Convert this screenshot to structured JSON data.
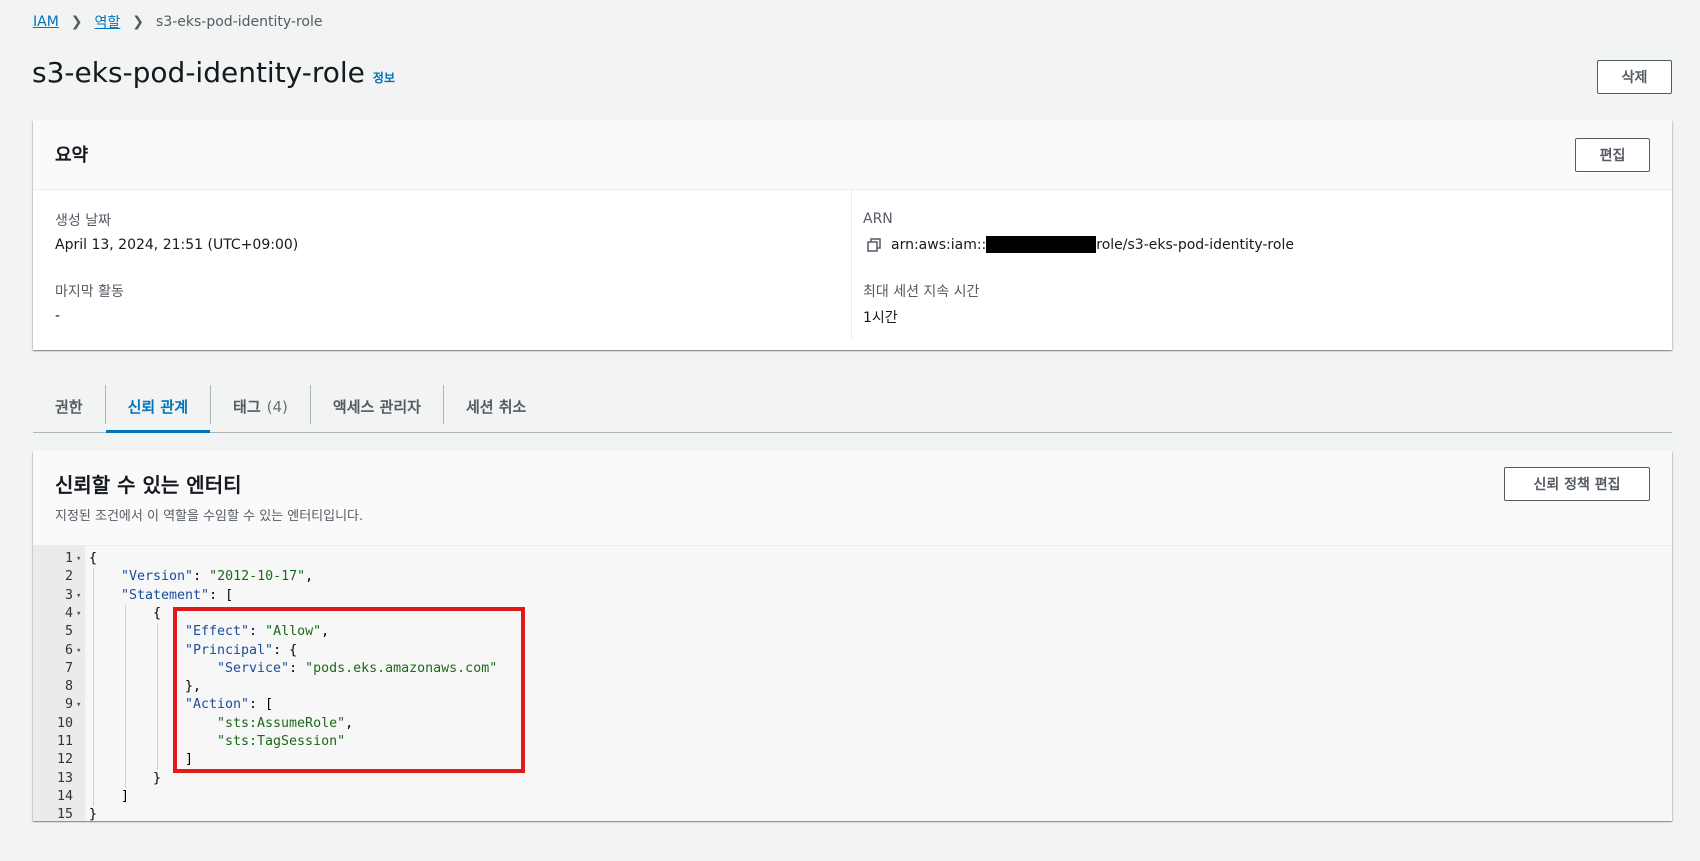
{
  "breadcrumb": {
    "items": [
      "IAM",
      "역할",
      "s3-eks-pod-identity-role"
    ]
  },
  "header": {
    "title": "s3-eks-pod-identity-role",
    "info_link": "정보",
    "delete_label": "삭제"
  },
  "summary": {
    "title": "요약",
    "edit_label": "편집",
    "created_label": "생성 날짜",
    "created_value": "April 13, 2024, 21:51 (UTC+09:00)",
    "last_activity_label": "마지막 활동",
    "last_activity_value": "-",
    "arn_label": "ARN",
    "arn_prefix": "arn:aws:iam::",
    "arn_suffix": "role/s3-eks-pod-identity-role",
    "max_session_label": "최대 세션 지속 시간",
    "max_session_value": "1시간"
  },
  "tabs": [
    {
      "label": "권한"
    },
    {
      "label": "신뢰 관계"
    },
    {
      "label": "태그",
      "count": "(4)"
    },
    {
      "label": "액세스 관리자"
    },
    {
      "label": "세션 취소"
    }
  ],
  "trust": {
    "title": "신뢰할 수 있는 엔터티",
    "description": "지정된 조건에서 이 역할을 수임할 수 있는 엔터티입니다.",
    "edit_label": "신뢰 정책 편집"
  },
  "code": {
    "lines": [
      {
        "n": "1",
        "fold": true,
        "indent": 0,
        "parts": [
          [
            "p",
            "{"
          ]
        ]
      },
      {
        "n": "2",
        "fold": false,
        "indent": 1,
        "parts": [
          [
            "k",
            "\"Version\""
          ],
          [
            "p",
            ": "
          ],
          [
            "s",
            "\"2012-10-17\""
          ],
          [
            "p",
            ","
          ]
        ]
      },
      {
        "n": "3",
        "fold": true,
        "indent": 1,
        "parts": [
          [
            "k",
            "\"Statement\""
          ],
          [
            "p",
            ": ["
          ]
        ]
      },
      {
        "n": "4",
        "fold": true,
        "indent": 2,
        "parts": [
          [
            "p",
            "{"
          ]
        ]
      },
      {
        "n": "5",
        "fold": false,
        "indent": 3,
        "parts": [
          [
            "k",
            "\"Effect\""
          ],
          [
            "p",
            ": "
          ],
          [
            "s",
            "\"Allow\""
          ],
          [
            "p",
            ","
          ]
        ]
      },
      {
        "n": "6",
        "fold": true,
        "indent": 3,
        "parts": [
          [
            "k",
            "\"Principal\""
          ],
          [
            "p",
            ": {"
          ]
        ]
      },
      {
        "n": "7",
        "fold": false,
        "indent": 4,
        "parts": [
          [
            "k",
            "\"Service\""
          ],
          [
            "p",
            ": "
          ],
          [
            "s",
            "\"pods.eks.amazonaws.com\""
          ]
        ]
      },
      {
        "n": "8",
        "fold": false,
        "indent": 3,
        "parts": [
          [
            "p",
            "},"
          ]
        ]
      },
      {
        "n": "9",
        "fold": true,
        "indent": 3,
        "parts": [
          [
            "k",
            "\"Action\""
          ],
          [
            "p",
            ": ["
          ]
        ]
      },
      {
        "n": "10",
        "fold": false,
        "indent": 4,
        "parts": [
          [
            "s",
            "\"sts:AssumeRole\""
          ],
          [
            "p",
            ","
          ]
        ]
      },
      {
        "n": "11",
        "fold": false,
        "indent": 4,
        "parts": [
          [
            "s",
            "\"sts:TagSession\""
          ]
        ]
      },
      {
        "n": "12",
        "fold": false,
        "indent": 3,
        "parts": [
          [
            "p",
            "]"
          ]
        ]
      },
      {
        "n": "13",
        "fold": false,
        "indent": 2,
        "parts": [
          [
            "p",
            "}"
          ]
        ]
      },
      {
        "n": "14",
        "fold": false,
        "indent": 1,
        "parts": [
          [
            "p",
            "]"
          ]
        ]
      },
      {
        "n": "15",
        "fold": false,
        "indent": 0,
        "parts": [
          [
            "p",
            "}"
          ]
        ]
      }
    ]
  },
  "colors": {
    "link": "#0073bb",
    "highlight": "#e0191b",
    "key": "#1a4d9c",
    "string": "#1a6a1a"
  }
}
